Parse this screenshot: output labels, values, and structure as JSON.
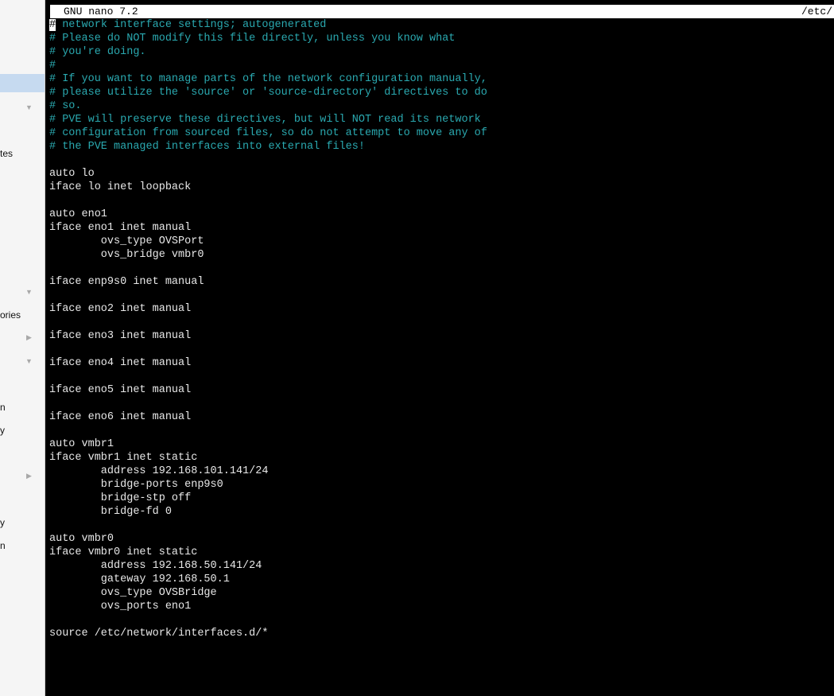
{
  "sidebar": {
    "fragments": [
      "tes",
      "ories",
      "n",
      "y",
      "y",
      "n"
    ]
  },
  "nano": {
    "title_left": "GNU nano 7.2",
    "title_right": "/etc/"
  },
  "file_lines": [
    {
      "text": "# network interface settings; autogenerated",
      "comment": true
    },
    {
      "text": "# Please do NOT modify this file directly, unless you know what",
      "comment": true
    },
    {
      "text": "# you're doing.",
      "comment": true
    },
    {
      "text": "#",
      "comment": true
    },
    {
      "text": "# If you want to manage parts of the network configuration manually,",
      "comment": true
    },
    {
      "text": "# please utilize the 'source' or 'source-directory' directives to do",
      "comment": true
    },
    {
      "text": "# so.",
      "comment": true
    },
    {
      "text": "# PVE will preserve these directives, but will NOT read its network",
      "comment": true
    },
    {
      "text": "# configuration from sourced files, so do not attempt to move any of",
      "comment": true
    },
    {
      "text": "# the PVE managed interfaces into external files!",
      "comment": true
    },
    {
      "text": "",
      "comment": false
    },
    {
      "text": "auto lo",
      "comment": false
    },
    {
      "text": "iface lo inet loopback",
      "comment": false
    },
    {
      "text": "",
      "comment": false
    },
    {
      "text": "auto eno1",
      "comment": false
    },
    {
      "text": "iface eno1 inet manual",
      "comment": false
    },
    {
      "text": "        ovs_type OVSPort",
      "comment": false
    },
    {
      "text": "        ovs_bridge vmbr0",
      "comment": false
    },
    {
      "text": "",
      "comment": false
    },
    {
      "text": "iface enp9s0 inet manual",
      "comment": false
    },
    {
      "text": "",
      "comment": false
    },
    {
      "text": "iface eno2 inet manual",
      "comment": false
    },
    {
      "text": "",
      "comment": false
    },
    {
      "text": "iface eno3 inet manual",
      "comment": false
    },
    {
      "text": "",
      "comment": false
    },
    {
      "text": "iface eno4 inet manual",
      "comment": false
    },
    {
      "text": "",
      "comment": false
    },
    {
      "text": "iface eno5 inet manual",
      "comment": false
    },
    {
      "text": "",
      "comment": false
    },
    {
      "text": "iface eno6 inet manual",
      "comment": false
    },
    {
      "text": "",
      "comment": false
    },
    {
      "text": "auto vmbr1",
      "comment": false
    },
    {
      "text": "iface vmbr1 inet static",
      "comment": false
    },
    {
      "text": "        address 192.168.101.141/24",
      "comment": false
    },
    {
      "text": "        bridge-ports enp9s0",
      "comment": false
    },
    {
      "text": "        bridge-stp off",
      "comment": false
    },
    {
      "text": "        bridge-fd 0",
      "comment": false
    },
    {
      "text": "",
      "comment": false
    },
    {
      "text": "auto vmbr0",
      "comment": false
    },
    {
      "text": "iface vmbr0 inet static",
      "comment": false
    },
    {
      "text": "        address 192.168.50.141/24",
      "comment": false
    },
    {
      "text": "        gateway 192.168.50.1",
      "comment": false
    },
    {
      "text": "        ovs_type OVSBridge",
      "comment": false
    },
    {
      "text": "        ovs_ports eno1",
      "comment": false
    },
    {
      "text": "",
      "comment": false
    },
    {
      "text": "source /etc/network/interfaces.d/*",
      "comment": false
    }
  ],
  "colors": {
    "comment": "#2aa9b0",
    "text": "#e8e8e8",
    "background": "#000000",
    "titlebar": "#ffffff",
    "sidebar_selected": "#c6daf0"
  }
}
